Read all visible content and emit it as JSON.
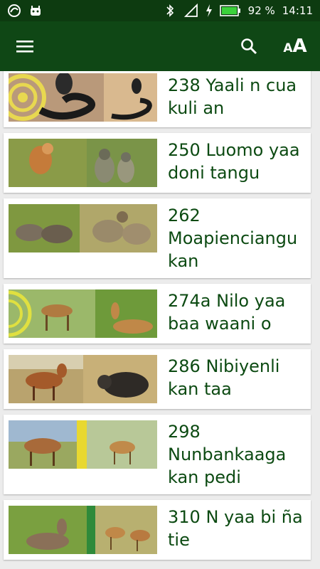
{
  "status_bar": {
    "battery_percent": "92 %",
    "time": "14:11",
    "icons": [
      "app-notification-icon",
      "android-notification-icon",
      "bluetooth-icon",
      "signal-icon",
      "charging-icon",
      "battery-icon"
    ]
  },
  "app_bar": {
    "menu_icon": "hamburger-menu-icon",
    "search_icon": "search-icon",
    "font_size_icon": "font-size-icon",
    "font_size_label_small": "A",
    "font_size_label_large": "A"
  },
  "colors": {
    "status_bar": "#0d3b10",
    "app_bar": "#0f4715",
    "title_text": "#0c4a12",
    "background": "#ececec"
  },
  "items": [
    {
      "title": "238 Yaali n cua kuli an",
      "image": "snake-thumbnail"
    },
    {
      "title": "250 Luomo yaa doni tangu",
      "image": "monkey-thumbnail"
    },
    {
      "title": "262 Moapienciangu kan",
      "image": "warthog-baboon-thumbnail"
    },
    {
      "title": "274a Nilo yaa baa waani o",
      "image": "antelope-thumbnail"
    },
    {
      "title": "286 Nibiyenli kan taa",
      "image": "hartebeest-buffalo-thumbnail"
    },
    {
      "title": "298 Nunbankaaga kan pedi",
      "image": "roan-kob-thumbnail"
    },
    {
      "title": "310 N yaa bi ña tie",
      "image": "waterbuck-thumbnail"
    }
  ]
}
